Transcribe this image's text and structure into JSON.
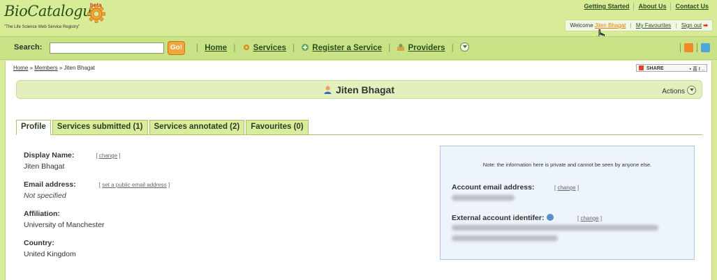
{
  "brand": {
    "logo_text": "BioCatalogue",
    "beta": "beta",
    "tagline": "\"The Life Science Web Service Registry\""
  },
  "top_links": [
    "Getting Started",
    "About Us",
    "Contact Us"
  ],
  "welcome": {
    "prefix": "Welcome",
    "user": "Jiten Bhagat",
    "favourites": "My Favourites",
    "signout": "Sign out",
    "signout_arrow": "➡"
  },
  "search": {
    "label": "Search:",
    "value": "",
    "placeholder": "",
    "go_label": "Go!"
  },
  "nav": {
    "home": "Home",
    "services": "Services",
    "register": "Register a Service",
    "providers": "Providers"
  },
  "breadcrumb": {
    "home": "Home",
    "sep": "»",
    "members": "Members",
    "current": "Jiten Bhagat"
  },
  "share": {
    "label": "SHARE",
    "extra": "▪ 喜 ℓ .."
  },
  "profile_title": "Jiten Bhagat",
  "actions_label": "Actions",
  "tabs": [
    "Profile",
    "Services submitted (1)",
    "Services annotated (2)",
    "Favourites (0)"
  ],
  "fields": {
    "display_name": {
      "label": "Display Name:",
      "value": "Jiten Bhagat",
      "action": "change"
    },
    "email": {
      "label": "Email address:",
      "value": "Not specified",
      "action": "set a public email address"
    },
    "affiliation": {
      "label": "Affiliation:",
      "value": "University of Manchester"
    },
    "country": {
      "label": "Country:",
      "value": "United Kingdom"
    }
  },
  "private_box": {
    "note": "Note: the information here is private and cannot be seen by anyone else.",
    "account_email_label": "Account email address:",
    "external_id_label": "External account identifer:",
    "change": "change"
  },
  "colors": {
    "header_bg": "#d8ec98",
    "nav_bg": "#c9e286",
    "link": "#2a4f1e",
    "accent_orange": "#f2a53c",
    "private_bg": "#eef4fb"
  }
}
